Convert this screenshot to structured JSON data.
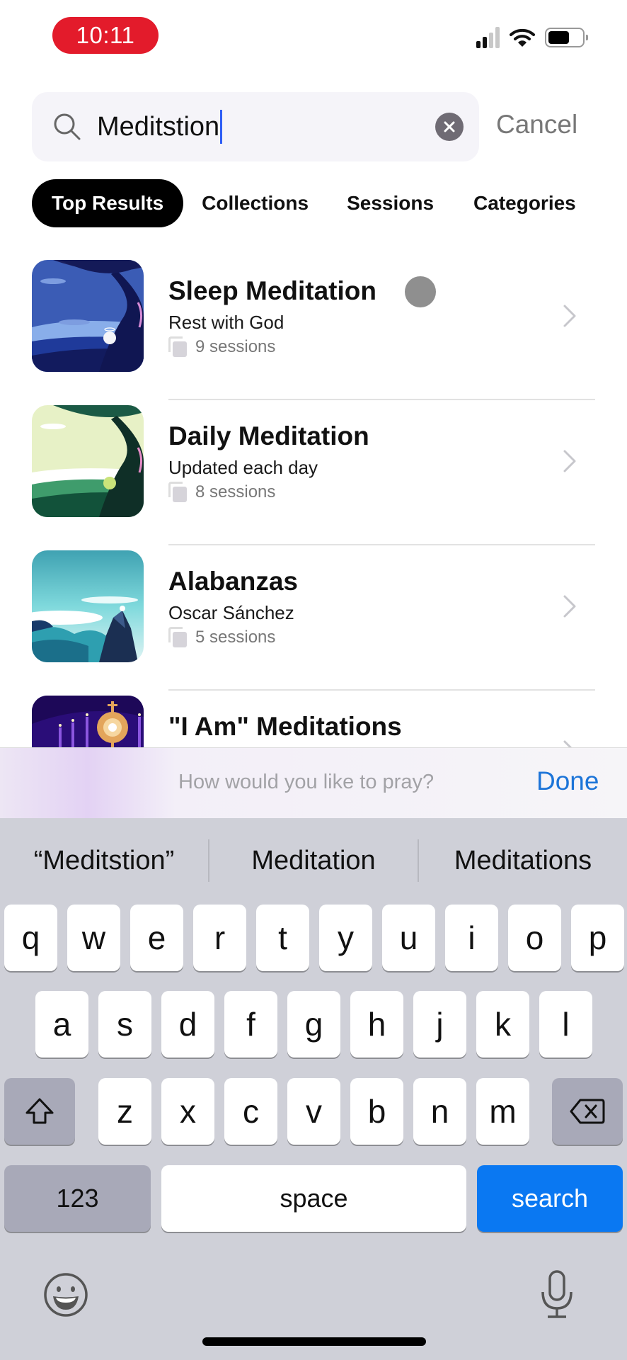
{
  "status_bar": {
    "time": "10:11",
    "time_pill_color": "#e31b2b",
    "signal_icon": "cellular-signal-icon",
    "wifi_icon": "wifi-icon",
    "battery_icon": "battery-icon",
    "battery_level_percent": 62
  },
  "search": {
    "value": "Meditstion",
    "search_icon": "search-icon",
    "clear_icon": "clear-icon",
    "cancel_label": "Cancel"
  },
  "tabs": [
    {
      "label": "Top Results",
      "active": true
    },
    {
      "label": "Collections",
      "active": false
    },
    {
      "label": "Sessions",
      "active": false
    },
    {
      "label": "Categories",
      "active": false
    }
  ],
  "results": [
    {
      "title": "Sleep Meditation",
      "subtitle": "Rest with God",
      "sessions": "9 sessions",
      "thumb": "night-tree-art"
    },
    {
      "title": "Daily Meditation",
      "subtitle": "Updated each day",
      "sessions": "8 sessions",
      "thumb": "day-tree-art"
    },
    {
      "title": "Alabanzas",
      "subtitle": "Oscar Sánchez",
      "sessions": "5 sessions",
      "thumb": "mountain-clouds-art"
    },
    {
      "title": "\"I Am\" Meditations",
      "subtitle": "",
      "sessions": "",
      "thumb": "monstrance-candles-art"
    }
  ],
  "accessory_bar": {
    "prompt": "How would you like to pray?",
    "done_label": "Done",
    "done_color": "#1c74d8"
  },
  "keyboard": {
    "suggestions": [
      "“Meditstion”",
      "Meditation",
      "Meditations"
    ],
    "row1": [
      "q",
      "w",
      "e",
      "r",
      "t",
      "y",
      "u",
      "i",
      "o",
      "p"
    ],
    "row2": [
      "a",
      "s",
      "d",
      "f",
      "g",
      "h",
      "j",
      "k",
      "l"
    ],
    "row3": [
      "z",
      "x",
      "c",
      "v",
      "b",
      "n",
      "m"
    ],
    "shift_icon": "shift-icon",
    "delete_icon": "delete-icon",
    "numbers_label": "123",
    "space_label": "space",
    "search_label": "search",
    "search_key_color": "#0a78f2",
    "emoji_icon": "emoji-icon",
    "mic_icon": "microphone-icon"
  }
}
